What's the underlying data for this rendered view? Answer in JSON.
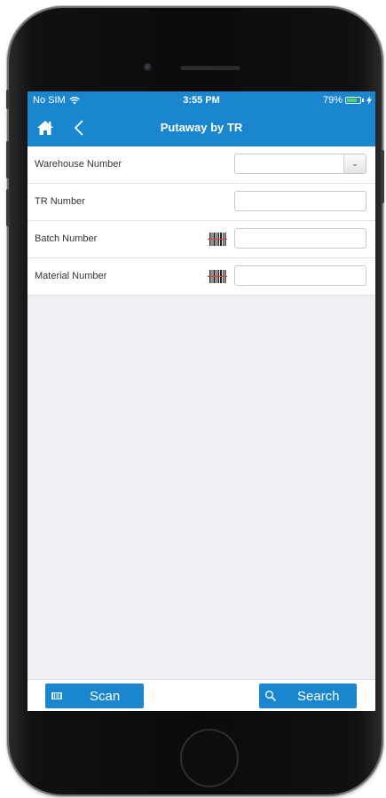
{
  "status_bar": {
    "carrier": "No SIM",
    "time": "3:55 PM",
    "battery": "79%",
    "battery_level": 0.79
  },
  "nav": {
    "title": "Putaway by TR",
    "back_label": "<"
  },
  "form": {
    "fields": [
      {
        "label": "Warehouse Number",
        "value": ""
      },
      {
        "label": "TR Number",
        "value": ""
      },
      {
        "label": "Batch Number",
        "value": ""
      },
      {
        "label": "Material Number",
        "value": ""
      }
    ]
  },
  "bottom": {
    "scan_label": "Scan",
    "search_label": "Search"
  },
  "colors": {
    "accent": "#1a86d0",
    "background": "#efeff4"
  },
  "icons": [
    "home-icon",
    "back-chevron-icon",
    "wifi-icon",
    "battery-icon",
    "charging-icon",
    "chevron-down-icon",
    "barcode-icon",
    "search-icon"
  ]
}
